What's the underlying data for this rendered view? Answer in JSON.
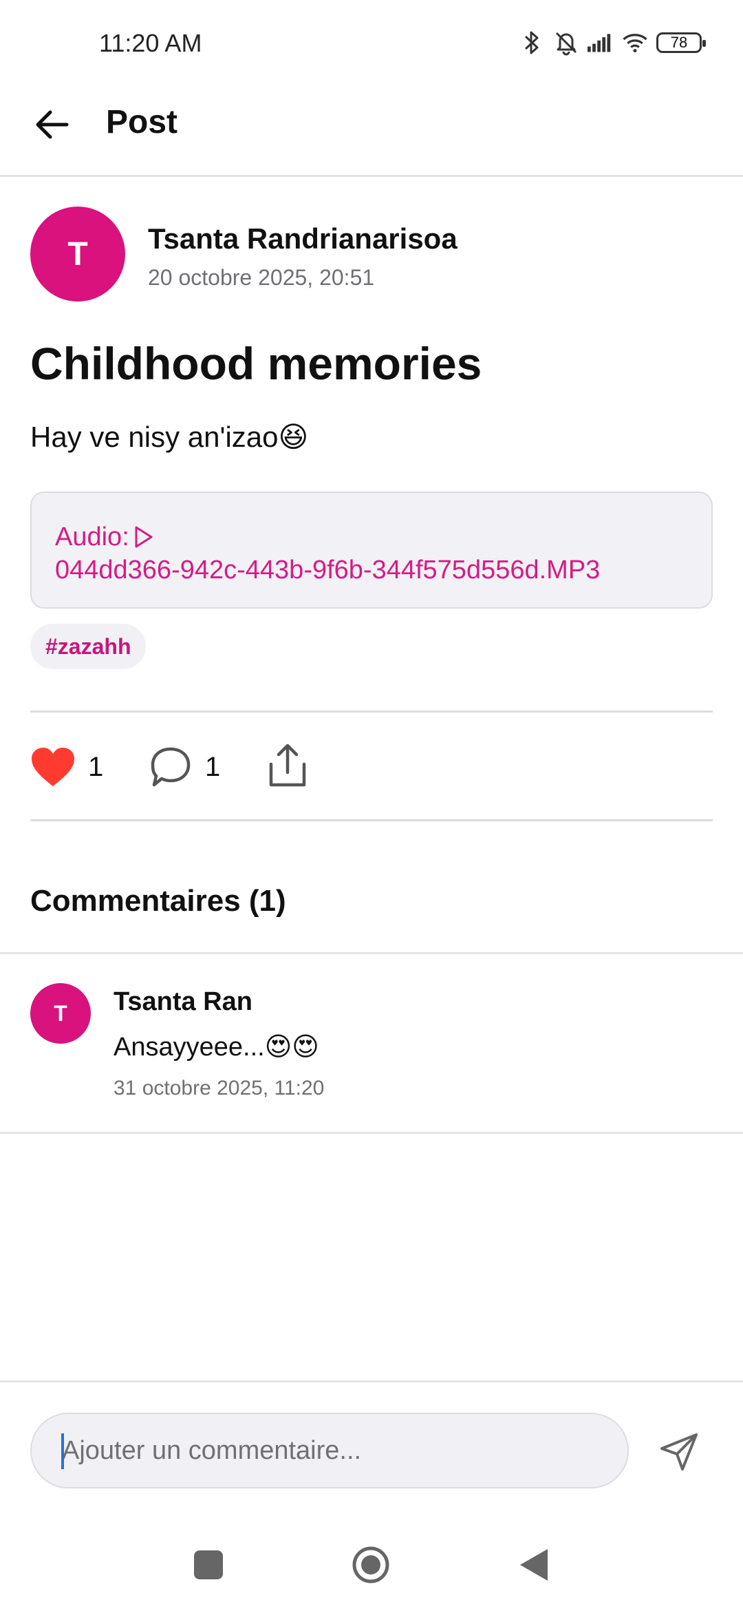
{
  "status_bar": {
    "time": "11:20 AM",
    "battery": "78"
  },
  "app_bar": {
    "title": "Post"
  },
  "post": {
    "author_initial": "T",
    "author_name": "Tsanta Randrianarisoa",
    "date": "20 octobre 2025, 20:51",
    "title": "Childhood memories",
    "body": "Hay ve nisy an'izao😆",
    "audio_label": "Audio:",
    "audio_file": "044dd366-942c-443b-9f6b-344f575d556d.MP3",
    "hashtag": "#zazahh",
    "like_count": "1",
    "comment_count": "1"
  },
  "comments_section": {
    "heading": "Commentaires (1)",
    "items": [
      {
        "initial": "T",
        "author": "Tsanta Ran",
        "text": "Ansayyeee...😍😍",
        "date": "31 octobre 2025, 11:20"
      }
    ]
  },
  "composer": {
    "placeholder": "Ajouter un commentaire..."
  },
  "colors": {
    "accent": "#d9127d",
    "like": "#ff3b30",
    "accent_text": "#d41c85"
  },
  "icons": [
    "bluetooth-icon",
    "bell-off-icon",
    "signal-icon",
    "wifi-icon",
    "battery-icon",
    "back-arrow-icon",
    "play-icon",
    "heart-icon",
    "comment-icon",
    "share-icon",
    "send-icon",
    "recents-icon",
    "home-icon",
    "nav-back-icon"
  ]
}
